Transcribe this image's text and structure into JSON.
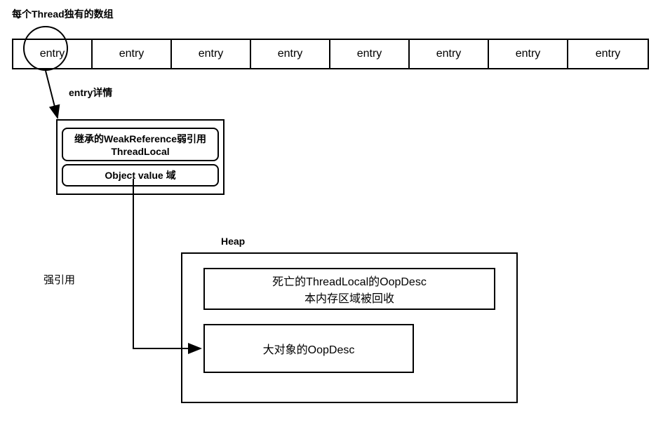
{
  "title": "每个Thread独有的数组",
  "array": {
    "cells": [
      "entry",
      "entry",
      "entry",
      "entry",
      "entry",
      "entry",
      "entry",
      "entry"
    ]
  },
  "entry_detail_label": "entry详情",
  "entry_box": {
    "field1_line1": "继承的WeakReference弱引用",
    "field1_line2": "ThreadLocal",
    "field2": "Object value 域"
  },
  "heap": {
    "label": "Heap",
    "dead_line1": "死亡的ThreadLocal的OopDesc",
    "dead_line2": "本内存区域被回收",
    "big_object": "大对象的OopDesc"
  },
  "strong_ref_label": "强引用"
}
